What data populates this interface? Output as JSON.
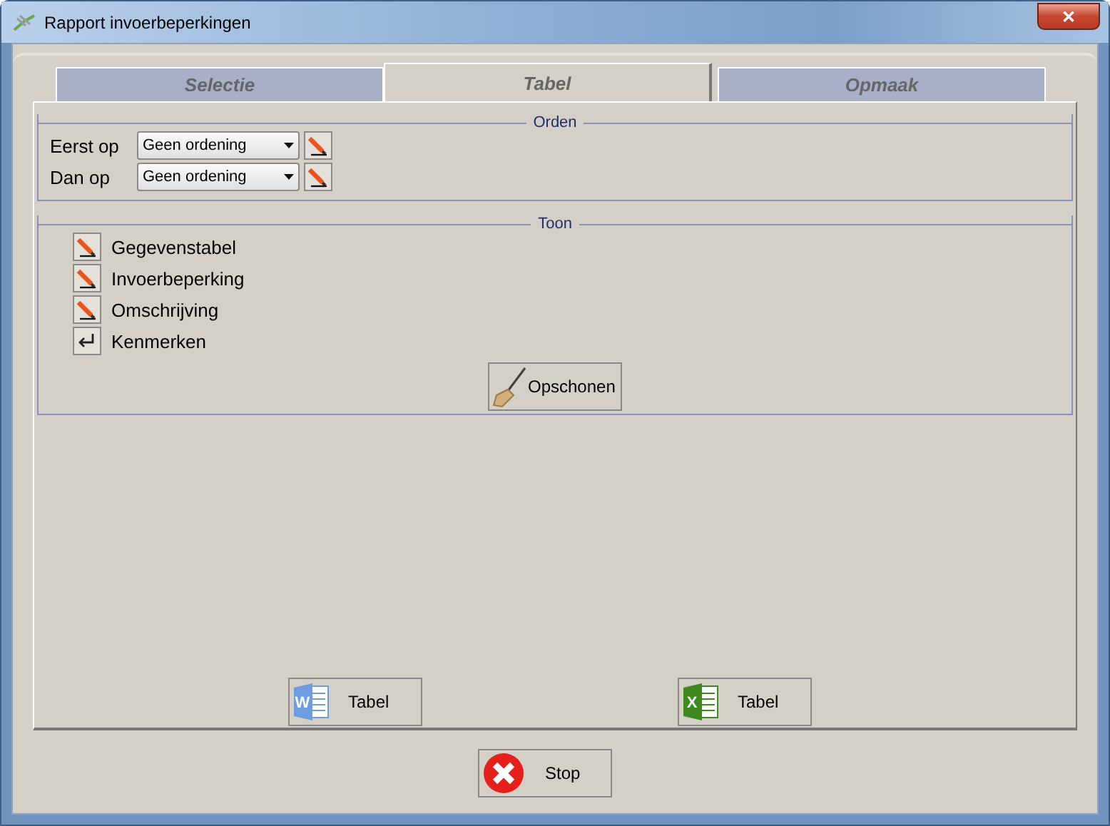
{
  "window": {
    "title": "Rapport invoerbeperkingen",
    "close": "✕"
  },
  "tabs": [
    {
      "label": "Selectie",
      "selected": false
    },
    {
      "label": "Tabel",
      "selected": true
    },
    {
      "label": "Opmaak",
      "selected": false
    }
  ],
  "orden": {
    "title": "Orden",
    "rows": [
      {
        "label": "Eerst op",
        "value": "Geen ordening"
      },
      {
        "label": "Dan op",
        "value": "Geen ordening"
      }
    ]
  },
  "toon": {
    "title": "Toon",
    "items": [
      {
        "label": "Gegevenstabel",
        "kind": "pencil"
      },
      {
        "label": "Invoerbeperking",
        "kind": "pencil"
      },
      {
        "label": "Omschrijving",
        "kind": "pencil"
      },
      {
        "label": "Kenmerken",
        "kind": "enter"
      }
    ],
    "clean_button": "Opschonen"
  },
  "export_buttons": [
    {
      "kind": "word",
      "icon_letter": "W",
      "label": "Tabel"
    },
    {
      "kind": "excel",
      "icon_letter": "X",
      "label": "Tabel"
    }
  ],
  "stop_button": "Stop"
}
